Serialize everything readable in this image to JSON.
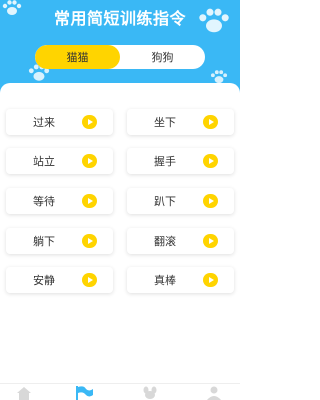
{
  "header": {
    "title": "常用简短训练指令",
    "bg_color": "#3ab8f5"
  },
  "tabs": [
    {
      "label": "猫猫",
      "active": true
    },
    {
      "label": "狗狗",
      "active": false
    }
  ],
  "accent_color": "#ffd400",
  "commands": [
    {
      "label": "过来",
      "icon": "play-icon"
    },
    {
      "label": "坐下",
      "icon": "play-icon"
    },
    {
      "label": "站立",
      "icon": "play-icon"
    },
    {
      "label": "握手",
      "icon": "play-icon"
    },
    {
      "label": "等待",
      "icon": "play-icon"
    },
    {
      "label": "趴下",
      "icon": "play-icon"
    },
    {
      "label": "躺下",
      "icon": "play-icon"
    },
    {
      "label": "翻滚",
      "icon": "play-icon"
    },
    {
      "label": "安静",
      "icon": "play-icon"
    },
    {
      "label": "真棒",
      "icon": "play-icon"
    }
  ],
  "bottom_nav": [
    {
      "icon": "home-icon",
      "active": false
    },
    {
      "icon": "flag-icon",
      "active": true
    },
    {
      "icon": "dog-icon",
      "active": false
    },
    {
      "icon": "user-icon",
      "active": false
    }
  ]
}
